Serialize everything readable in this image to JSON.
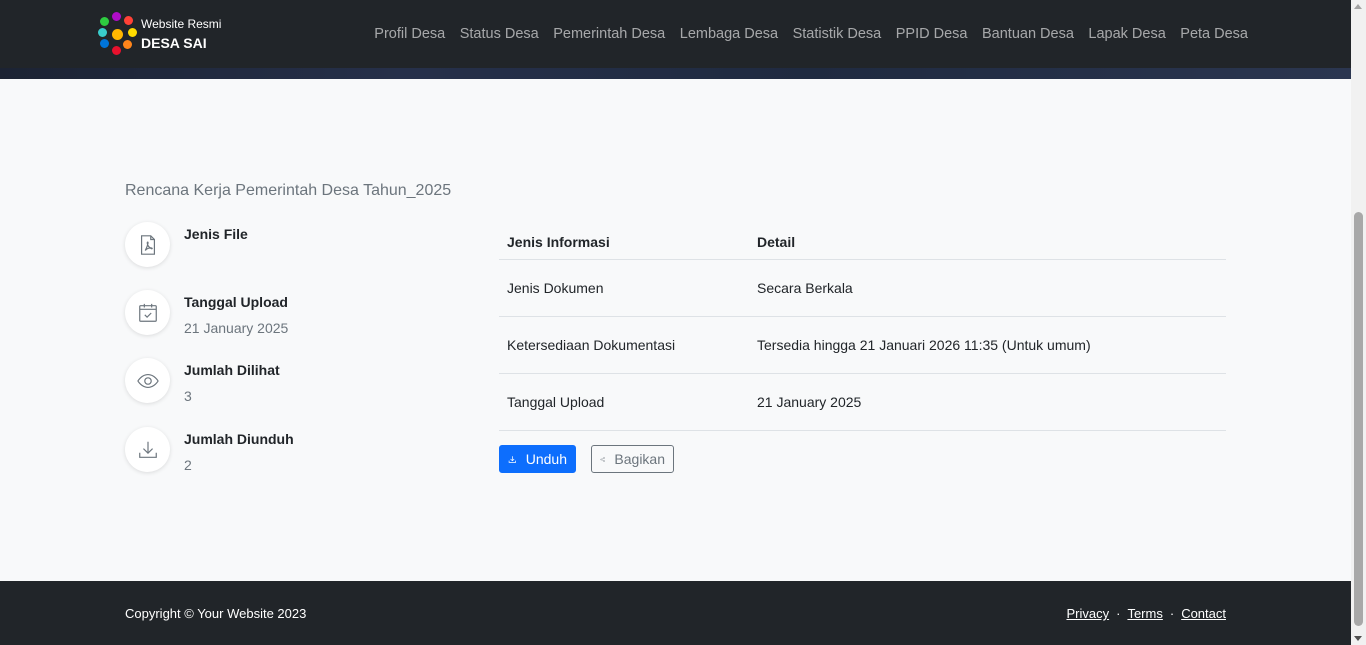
{
  "brand": {
    "small": "Website Resmi",
    "big": "DESA SAI"
  },
  "nav": [
    {
      "label": "Profil Desa",
      "name": "nav-profil-desa"
    },
    {
      "label": "Status Desa",
      "name": "nav-status-desa"
    },
    {
      "label": "Pemerintah Desa",
      "name": "nav-pemerintah-desa"
    },
    {
      "label": "Lembaga Desa",
      "name": "nav-lembaga-desa"
    },
    {
      "label": "Statistik Desa",
      "name": "nav-statistik-desa"
    },
    {
      "label": "PPID Desa",
      "name": "nav-ppid-desa"
    },
    {
      "label": "Bantuan Desa",
      "name": "nav-bantuan-desa"
    },
    {
      "label": "Lapak Desa",
      "name": "nav-lapak-desa"
    },
    {
      "label": "Peta Desa",
      "name": "nav-peta-desa"
    }
  ],
  "document": {
    "title": "Rencana Kerja Pemerintah Desa Tahun_2025"
  },
  "meta": [
    {
      "label": "Jenis File",
      "value": "",
      "icon": "pdf-file-icon"
    },
    {
      "label": "Tanggal Upload",
      "value": "21 January 2025",
      "icon": "calendar-check-icon"
    },
    {
      "label": "Jumlah Dilihat",
      "value": "3",
      "icon": "eye-icon"
    },
    {
      "label": "Jumlah Diunduh",
      "value": "2",
      "icon": "download-icon"
    }
  ],
  "table": {
    "headers": [
      "Jenis Informasi",
      "Detail"
    ],
    "rows": [
      [
        "Jenis Dokumen",
        "Secara Berkala"
      ],
      [
        "Ketersediaan Dokumentasi",
        "Tersedia hingga 21 Januari 2026 11:35 (Untuk umum)"
      ],
      [
        "Tanggal Upload",
        "21 January 2025"
      ]
    ]
  },
  "actions": {
    "download": "Unduh",
    "share": "Bagikan"
  },
  "footer": {
    "copyright": "Copyright © Your Website 2023",
    "links": [
      "Privacy",
      "Terms",
      "Contact"
    ],
    "separator": "·"
  }
}
